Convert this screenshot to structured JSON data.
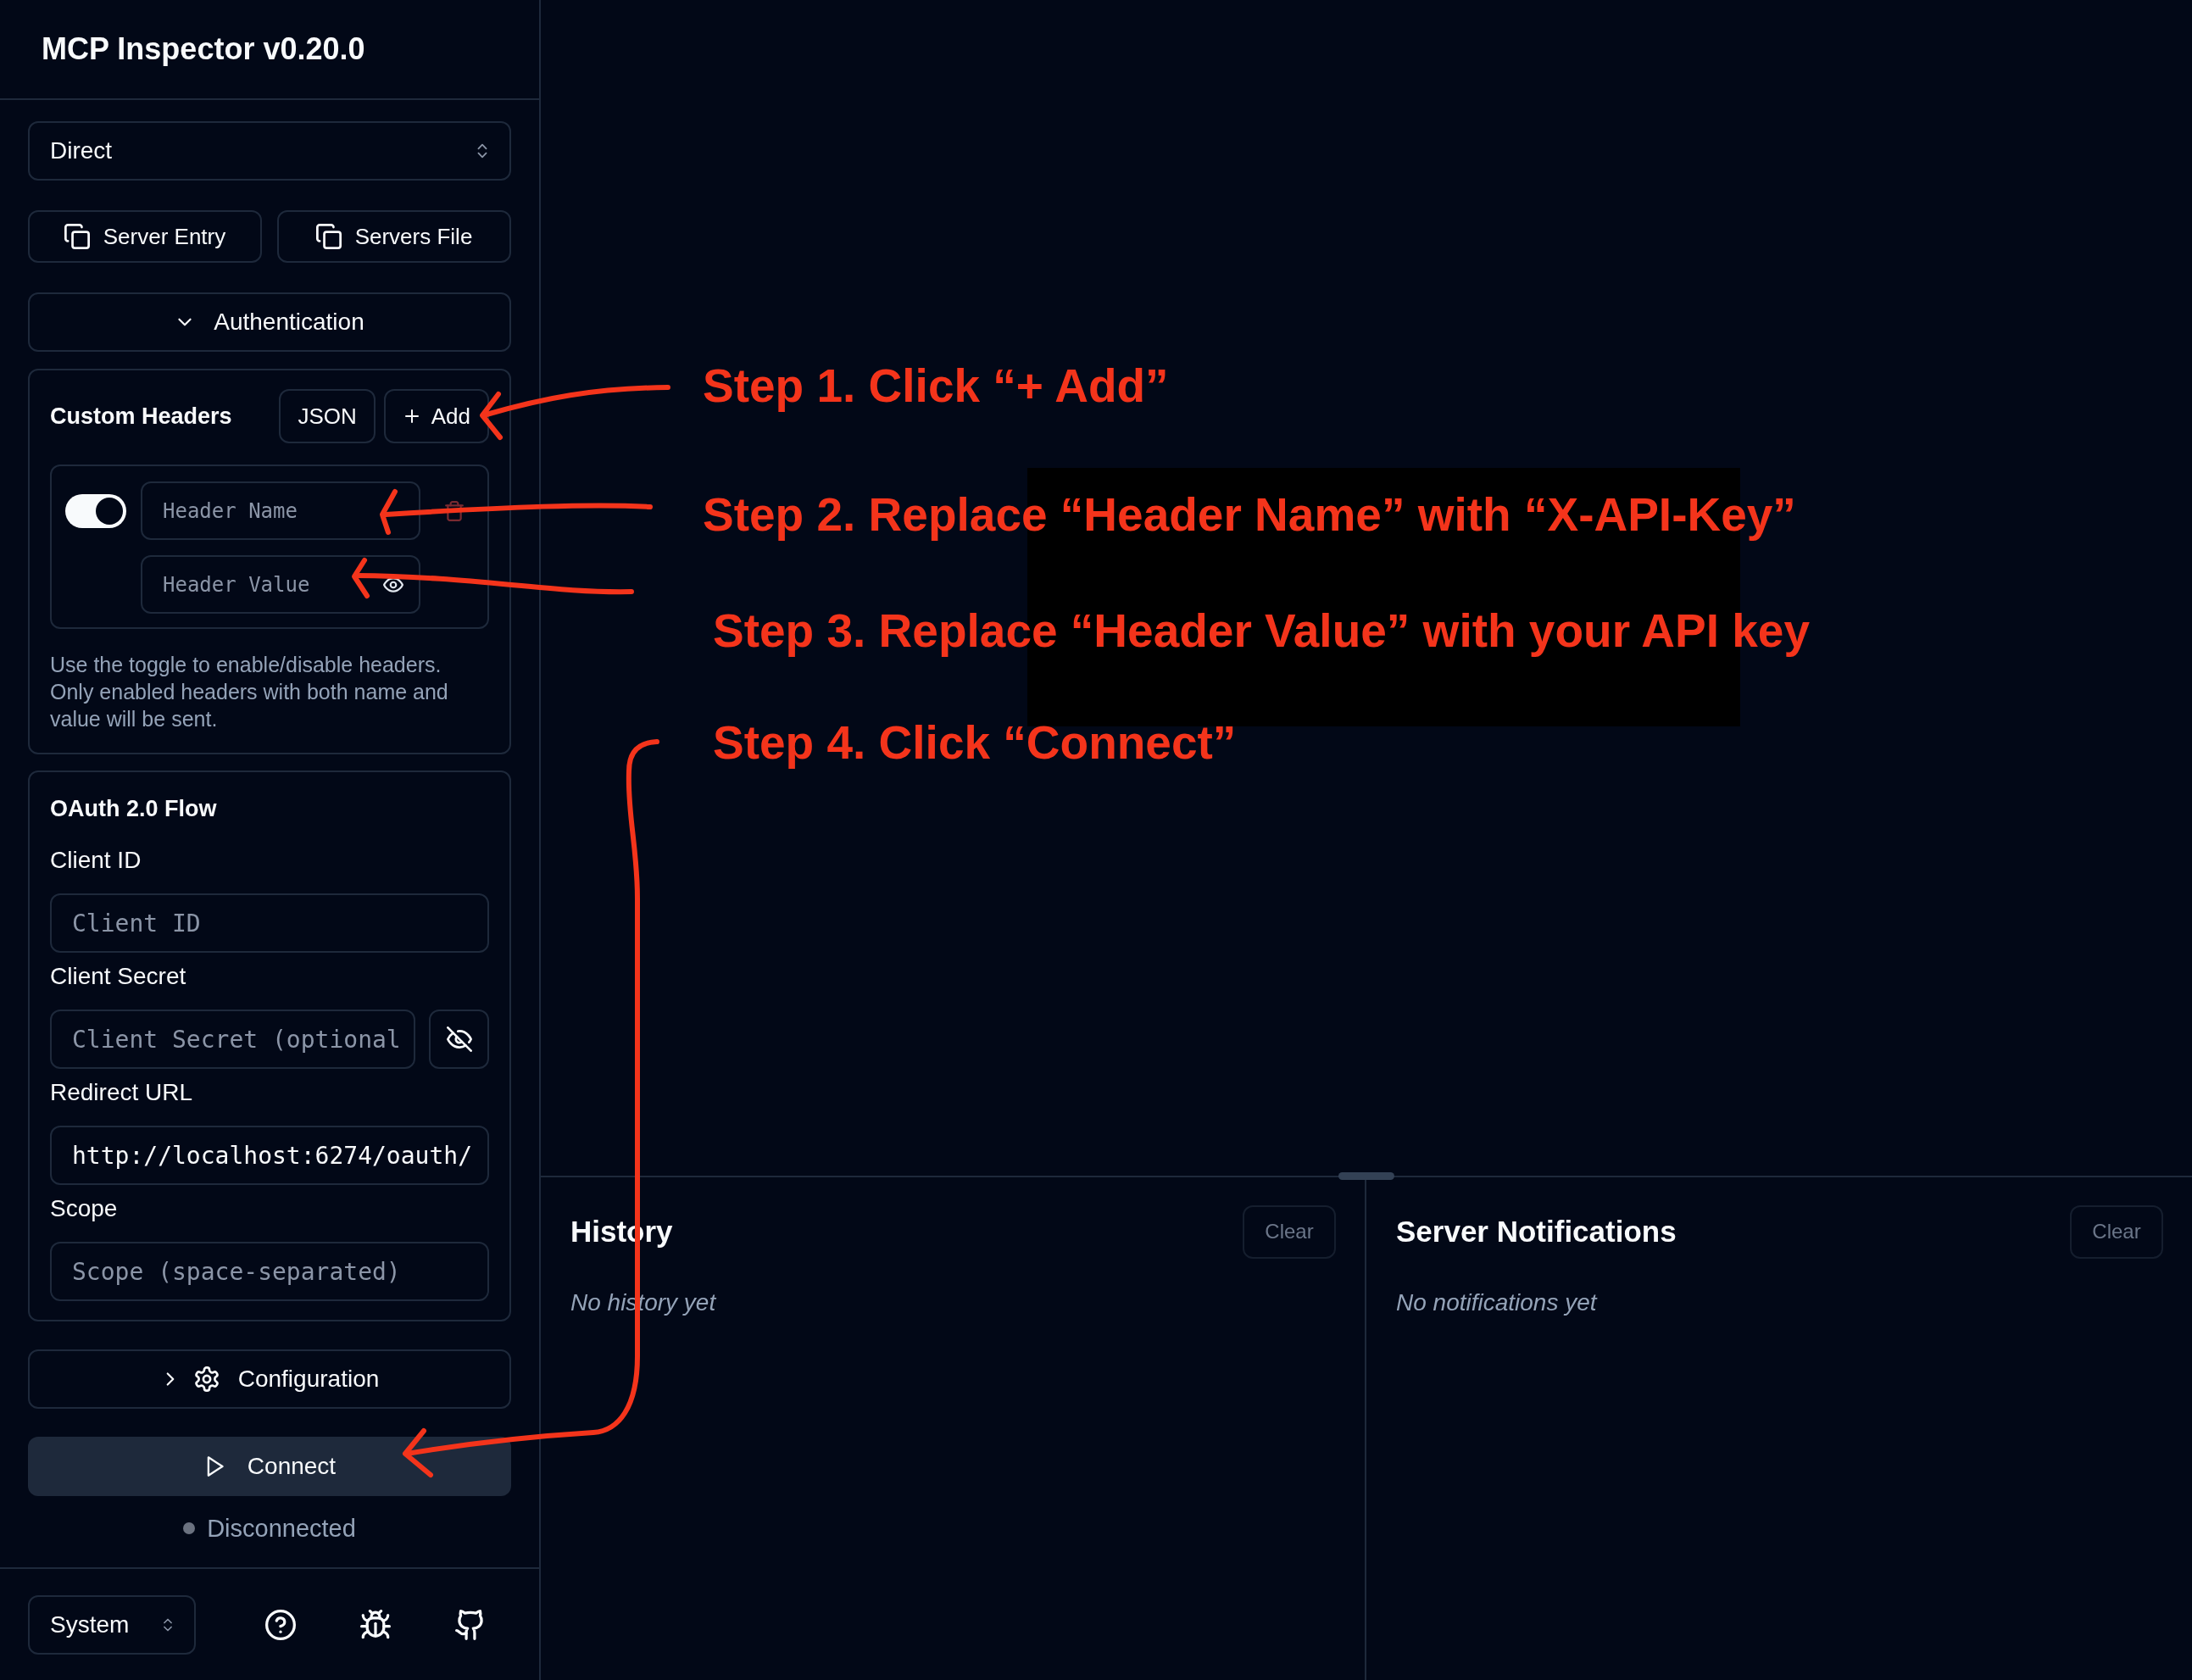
{
  "sidebar": {
    "title": "MCP Inspector v0.20.0",
    "transport": {
      "value": "Direct"
    },
    "copy_buttons": [
      {
        "label": "Server Entry"
      },
      {
        "label": "Servers File"
      }
    ],
    "authentication": {
      "label": "Authentication",
      "expanded": true
    },
    "custom_headers": {
      "title": "Custom Headers",
      "json_button": "JSON",
      "add_button": "Add",
      "headers": [
        {
          "enabled": true,
          "name_placeholder": "Header Name",
          "value_placeholder": "Header Value"
        }
      ],
      "help": "Use the toggle to enable/disable headers. Only enabled headers with both name and value will be sent."
    },
    "oauth": {
      "title": "OAuth 2.0 Flow",
      "fields": [
        {
          "kind": "text",
          "label": "Client ID",
          "placeholder": "Client ID"
        },
        {
          "kind": "secret",
          "label": "Client Secret",
          "placeholder": "Client Secret (optional"
        },
        {
          "kind": "text",
          "label": "Redirect URL",
          "value": "http://localhost:6274/oauth/"
        },
        {
          "kind": "text",
          "label": "Scope",
          "placeholder": "Scope (space-separated)"
        }
      ]
    },
    "configuration": {
      "label": "Configuration",
      "expanded": false
    },
    "connect_button": "Connect",
    "status": {
      "text": "Disconnected",
      "connected": false
    },
    "theme": {
      "value": "System"
    }
  },
  "panels": [
    {
      "title": "History",
      "clear_button": "Clear",
      "disabled": true,
      "empty_text": "No history yet"
    },
    {
      "title": "Server Notifications",
      "clear_button": "Clear",
      "disabled": true,
      "empty_text": "No notifications yet"
    }
  ],
  "annotations": [
    "Step 1. Click “+ Add”",
    "Step 2. Replace “Header Name” with “X-API-Key”",
    "Step 3. Replace “Header Value” with your API key",
    "Step 4. Click “Connect”"
  ]
}
